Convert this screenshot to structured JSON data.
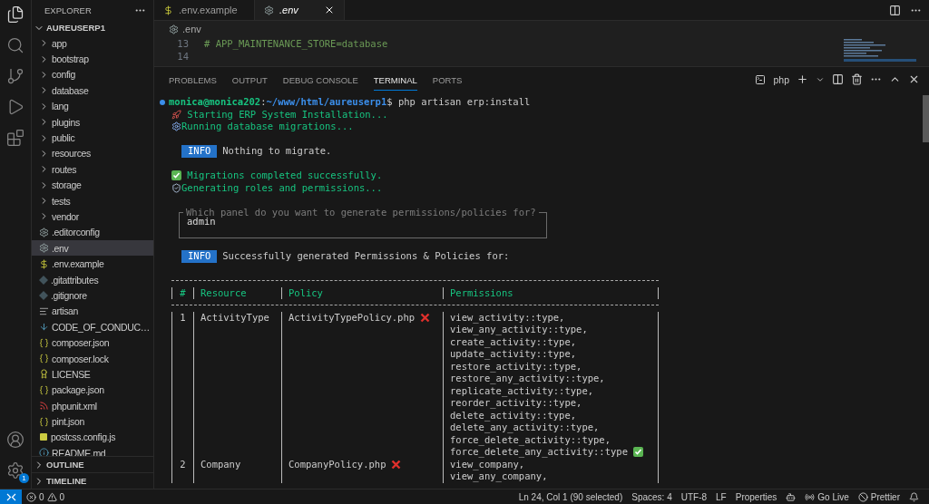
{
  "sidebar": {
    "title": "EXPLORER",
    "root": {
      "label": "AUREUSERP1",
      "expanded": true
    },
    "items": [
      {
        "name": "app",
        "kind": "folder",
        "selected": false
      },
      {
        "name": "bootstrap",
        "kind": "folder",
        "selected": false
      },
      {
        "name": "config",
        "kind": "folder",
        "selected": false
      },
      {
        "name": "database",
        "kind": "folder",
        "selected": false
      },
      {
        "name": "lang",
        "kind": "folder",
        "selected": false
      },
      {
        "name": "plugins",
        "kind": "folder",
        "selected": false
      },
      {
        "name": "public",
        "kind": "folder",
        "selected": false
      },
      {
        "name": "resources",
        "kind": "folder",
        "selected": false
      },
      {
        "name": "routes",
        "kind": "folder",
        "selected": false
      },
      {
        "name": "storage",
        "kind": "folder",
        "selected": false
      },
      {
        "name": "tests",
        "kind": "folder",
        "selected": false
      },
      {
        "name": "vendor",
        "kind": "folder",
        "selected": false
      },
      {
        "name": ".editorconfig",
        "kind": "gear",
        "selected": false
      },
      {
        "name": ".env",
        "kind": "gear",
        "selected": true
      },
      {
        "name": ".env.example",
        "kind": "dollar",
        "selected": false
      },
      {
        "name": ".gitattributes",
        "kind": "git",
        "selected": false
      },
      {
        "name": ".gitignore",
        "kind": "git",
        "selected": false
      },
      {
        "name": "artisan",
        "kind": "lines",
        "selected": false
      },
      {
        "name": "CODE_OF_CONDUC…",
        "kind": "download",
        "selected": false
      },
      {
        "name": "composer.json",
        "kind": "braces",
        "selected": false
      },
      {
        "name": "composer.lock",
        "kind": "braces",
        "selected": false
      },
      {
        "name": "LICENSE",
        "kind": "license",
        "selected": false
      },
      {
        "name": "package.json",
        "kind": "braces",
        "selected": false
      },
      {
        "name": "phpunit.xml",
        "kind": "rss",
        "selected": false
      },
      {
        "name": "pint.json",
        "kind": "braces",
        "selected": false
      },
      {
        "name": "postcss.config.js",
        "kind": "js",
        "selected": false
      },
      {
        "name": "README.md",
        "kind": "info",
        "selected": false
      }
    ],
    "sections": [
      {
        "label": "OUTLINE",
        "expanded": false
      },
      {
        "label": "TIMELINE",
        "expanded": false
      }
    ]
  },
  "settings_badge": "1",
  "tabs": [
    {
      "label": ".env.example",
      "kind": "dollar",
      "selected": false
    },
    {
      "label": ".env",
      "kind": "gear",
      "selected": true
    }
  ],
  "breadcrumb": ".env",
  "code_lines": [
    {
      "number": "13",
      "text": "# APP_MAINTENANCE_STORE=database"
    },
    {
      "number": "14"
    }
  ],
  "panel_tabs": [
    {
      "label": "PROBLEMS",
      "selected": false
    },
    {
      "label": "OUTPUT",
      "selected": false
    },
    {
      "label": "DEBUG CONSOLE",
      "selected": false
    },
    {
      "label": "TERMINAL",
      "selected": true
    },
    {
      "label": "PORTS",
      "selected": false
    }
  ],
  "terminal_name": "php",
  "terminal": {
    "prompt": {
      "user": "monica@monica202",
      "sep": ":",
      "path": "~/www/html/aureuserp1",
      "command": "$ php artisan erp:install"
    },
    "lines": [
      {
        "kind": "rocket",
        "text": " Starting ERP System Installation..."
      },
      {
        "kind": "gear",
        "text": "Running database migrations..."
      },
      {
        "kind": "blank"
      },
      {
        "kind": "info",
        "badge": "INFO",
        "text": "Nothing to migrate."
      },
      {
        "kind": "blank"
      },
      {
        "kind": "check",
        "text": " Migrations completed successfully."
      },
      {
        "kind": "shield",
        "text": "Generating roles and permissions..."
      },
      {
        "kind": "blank"
      },
      {
        "kind": "question",
        "label": "Which panel do you want to generate permissions/policies for?",
        "value": "admin"
      },
      {
        "kind": "blank"
      },
      {
        "kind": "info",
        "badge": "INFO",
        "text": "Successfully generated Permissions & Policies for:"
      },
      {
        "kind": "blank"
      }
    ],
    "table": {
      "columns": [
        "#",
        "Resource",
        "Policy",
        "Permissions"
      ],
      "rows": [
        {
          "number": "1",
          "resource": "ActivityType",
          "policy": "ActivityTypePolicy.php",
          "policy_exists": false,
          "done": true,
          "permissions": [
            "view_activity::type,",
            "view_any_activity::type,",
            "create_activity::type,",
            "update_activity::type,",
            "restore_activity::type,",
            "restore_any_activity::type,",
            "replicate_activity::type,",
            "reorder_activity::type,",
            "delete_activity::type,",
            "delete_any_activity::type,",
            "force_delete_activity::type,",
            "force_delete_any_activity::type"
          ]
        },
        {
          "number": "2",
          "resource": "Company",
          "policy": "CompanyPolicy.php",
          "policy_exists": false,
          "permissions": [
            "view_company,",
            "view_any_company,"
          ]
        }
      ]
    }
  },
  "status_bar": {
    "errors": "0",
    "warnings": "0",
    "position": "Ln 24, Col 1 (90 selected)",
    "indent": "Spaces: 4",
    "encoding": "UTF-8",
    "eol": "LF",
    "language": "Properties",
    "go_live": "Go Live",
    "prettier": "Prettier"
  }
}
